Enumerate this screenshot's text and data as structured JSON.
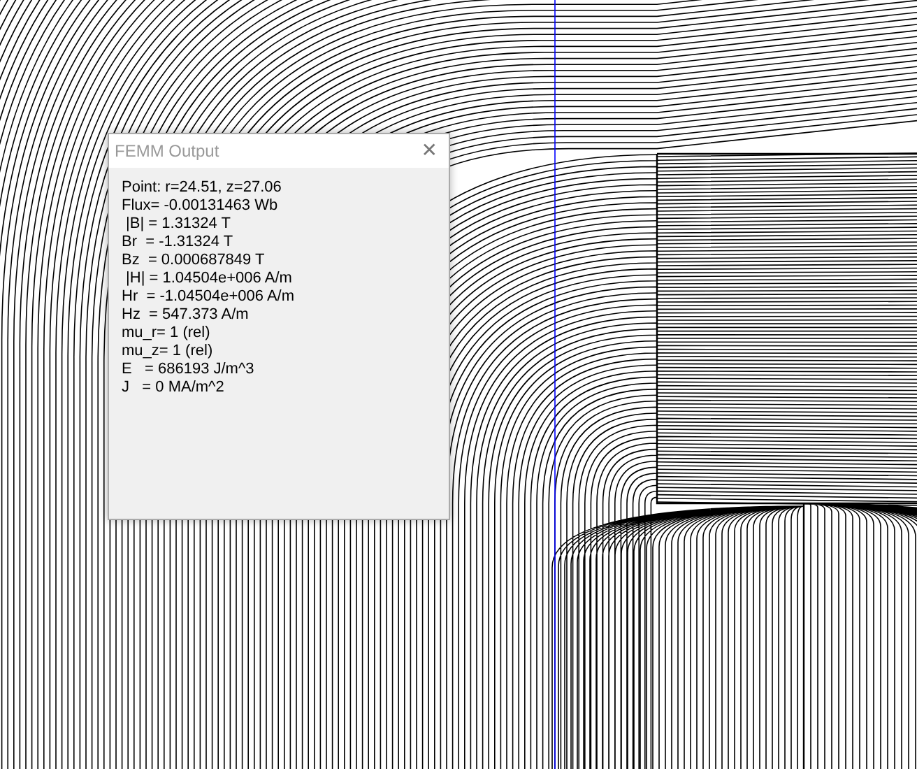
{
  "window": {
    "title": "FEMM Output",
    "close": "✕"
  },
  "lines": [
    "Point: r=24.51, z=27.06",
    "Flux= -0.00131463 Wb",
    " |B| = 1.31324 T",
    "Br  = -1.31324 T",
    "Bz  = 0.000687849 T",
    " |H| = 1.04504e+006 A/m",
    "Hr  = -1.04504e+006 A/m",
    "Hz  = 547.373 A/m",
    "mu_r= 1 (rel)",
    "mu_z= 1 (rel)",
    "E   = 686193 J/m^3",
    "J   = 0 MA/m^2"
  ]
}
